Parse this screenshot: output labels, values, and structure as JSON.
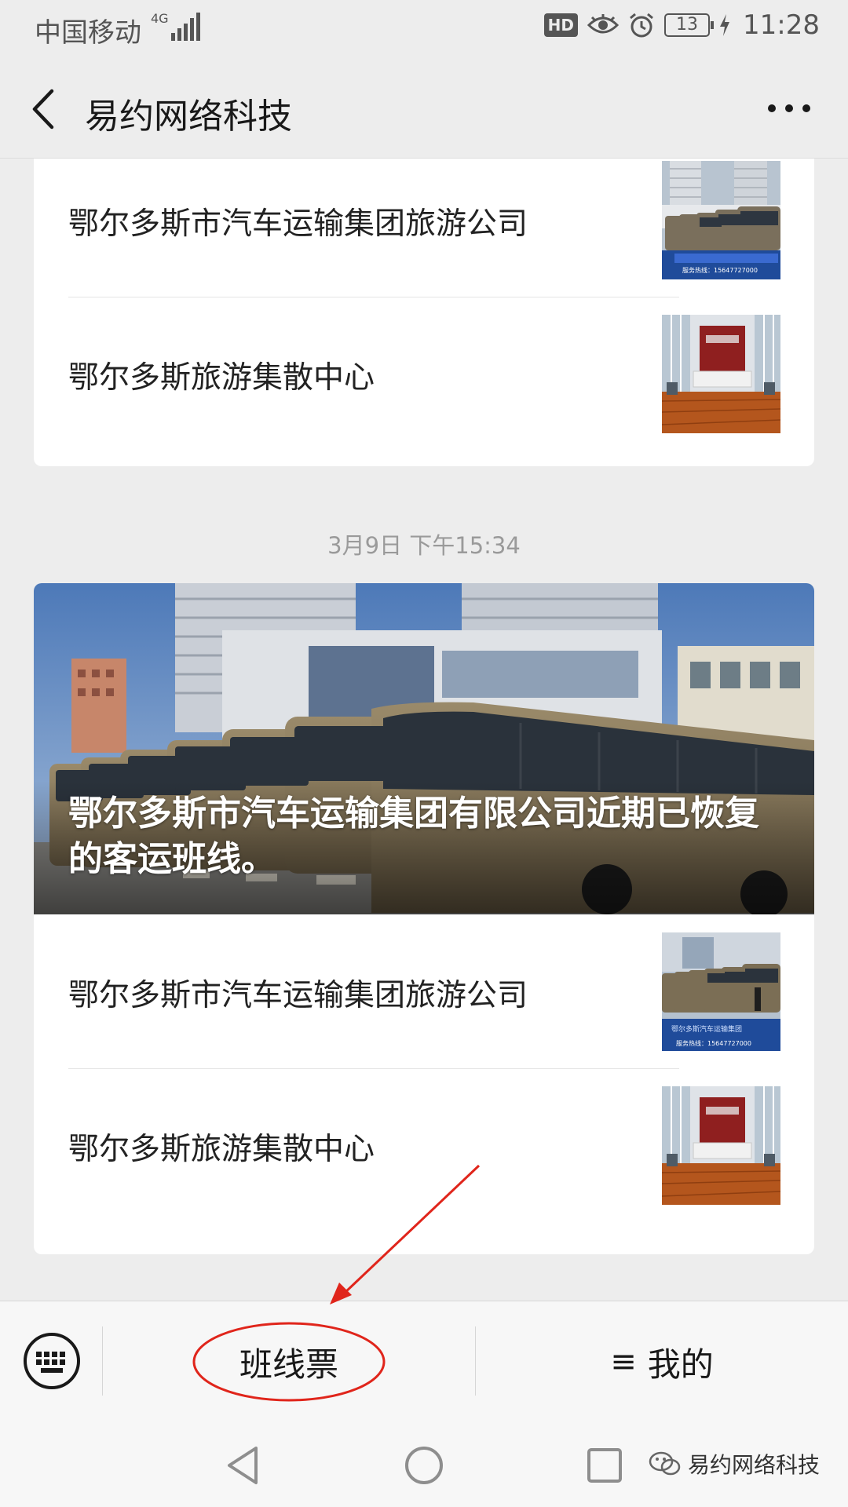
{
  "status_bar": {
    "carrier": "中国移动",
    "network": "4G",
    "hd": "HD",
    "battery": "13",
    "time": "11:28",
    "icons": [
      "signal-icon",
      "eye-icon",
      "alarm-icon",
      "battery-icon",
      "charging-icon"
    ]
  },
  "header": {
    "title": "易约网络科技",
    "back_icon": "chevron-left-icon",
    "more_icon": "more-dots-icon"
  },
  "feed": {
    "card_top": {
      "items": [
        {
          "title": "鄂尔多斯市汽车运输集团旅游公司",
          "thumb_caption": "服务热线：15647727000"
        },
        {
          "title": "鄂尔多斯旅游集散中心"
        }
      ]
    },
    "timestamp": "3月9日 下午15:34",
    "card_main": {
      "hero_title": "鄂尔多斯市汽车运输集团有限公司近期已恢复的客运班线。",
      "items": [
        {
          "title": "鄂尔多斯市汽车运输集团旅游公司",
          "thumb_caption": "服务热线：15647727000"
        },
        {
          "title": "鄂尔多斯旅游集散中心"
        }
      ]
    }
  },
  "menu": {
    "keyboard_icon": "keyboard-icon",
    "ticket_label": "班线票",
    "mine_icon": "≡",
    "mine_label": "我的"
  },
  "nav": {
    "watermark": "易约网络科技",
    "icons": [
      "back-triangle-icon",
      "home-circle-icon",
      "recents-square-icon"
    ]
  },
  "colors": {
    "background": "#ededed",
    "card": "#ffffff",
    "annotation_red": "#e0251b"
  }
}
